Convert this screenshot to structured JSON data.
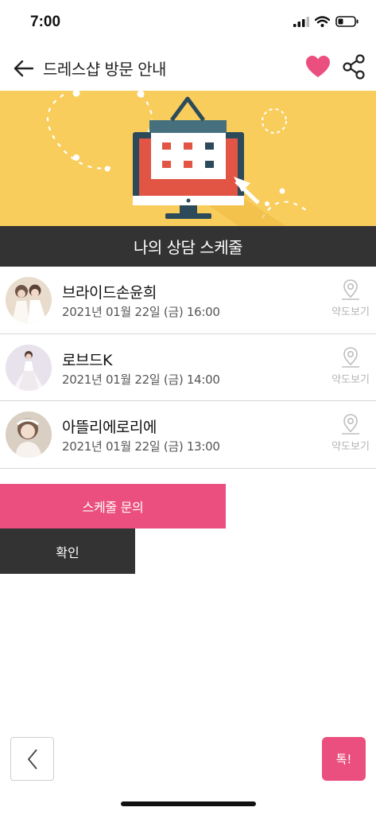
{
  "status_bar": {
    "time": "7:00"
  },
  "header": {
    "title": "드레스샵 방문 안내"
  },
  "banner": {
    "title": "나의 상담 스케줄"
  },
  "schedules": [
    {
      "name": "브라이드손윤희",
      "date": "2021년 01월 22일 (금) 16:00",
      "map_label": "약도보기"
    },
    {
      "name": "로브드K",
      "date": "2021년 01월 22일 (금) 14:00",
      "map_label": "약도보기"
    },
    {
      "name": "아뜰리에로리에",
      "date": "2021년 01월 22일 (금) 13:00",
      "map_label": "약도보기"
    }
  ],
  "actions": {
    "inquiry_label": "스케줄 문의",
    "confirm_label": "확인"
  },
  "bottom": {
    "talk_label": "톡!"
  },
  "colors": {
    "accent": "#ea4f7f",
    "banner_bg": "#f8cd5c",
    "dark_bar": "#333333"
  },
  "icons": [
    "back-arrow-icon",
    "heart-icon",
    "share-icon",
    "map-pin-icon",
    "chevron-left-icon",
    "signal-icon",
    "wifi-icon",
    "battery-icon"
  ]
}
